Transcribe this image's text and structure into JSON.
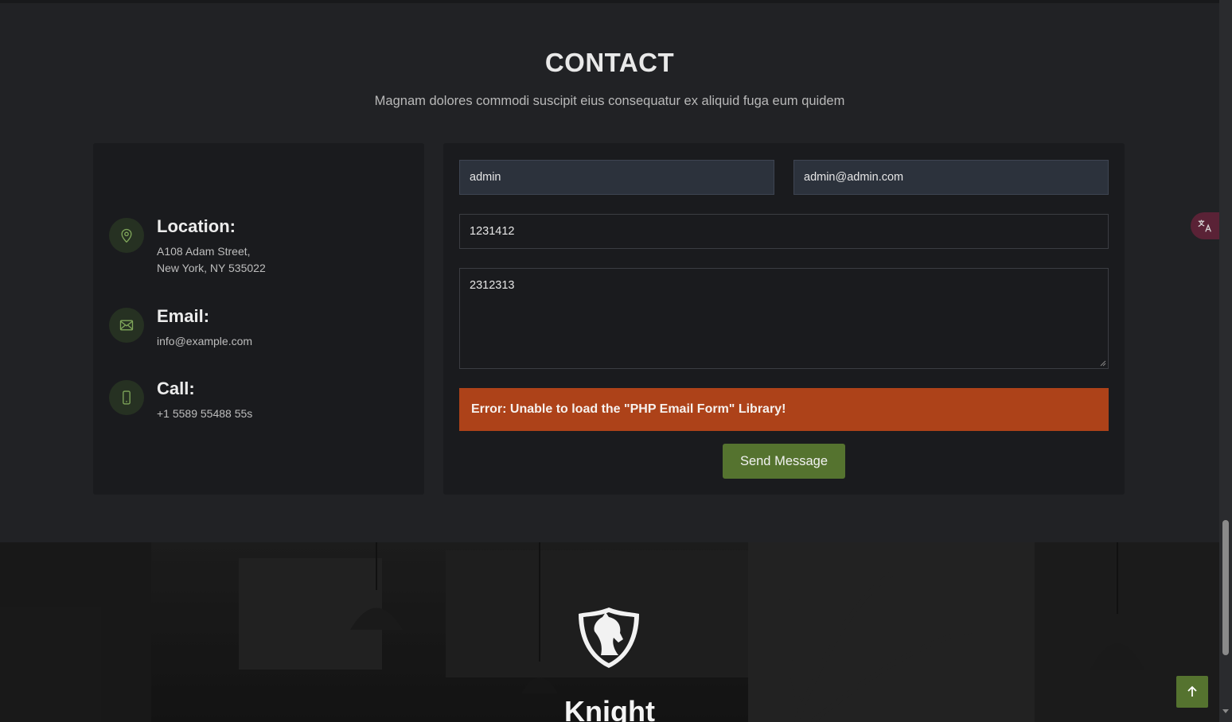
{
  "contact": {
    "title": "CONTACT",
    "subtitle": "Magnam dolores commodi suscipit eius consequatur ex aliquid fuga eum quidem"
  },
  "info": {
    "location": {
      "heading": "Location:",
      "line1": "A108 Adam Street,",
      "line2": "New York, NY 535022",
      "icon": "map-pin-icon"
    },
    "email": {
      "heading": "Email:",
      "text": "info@example.com",
      "icon": "envelope-icon"
    },
    "call": {
      "heading": "Call:",
      "text": "+1 5589 55488 55s",
      "icon": "phone-icon"
    }
  },
  "form": {
    "name_value": "admin",
    "email_value": "admin@admin.com",
    "subject_value": "1231412",
    "message_value": "2312313",
    "error_text": "Error: Unable to load the \"PHP Email Form\" Library!",
    "send_label": "Send Message"
  },
  "footer": {
    "brand": "Knight",
    "logo": "horse-shield-logo"
  },
  "colors": {
    "accent": "#55732f",
    "error": "#ad4219",
    "background": "#212225",
    "card": "#1a1b1e"
  }
}
